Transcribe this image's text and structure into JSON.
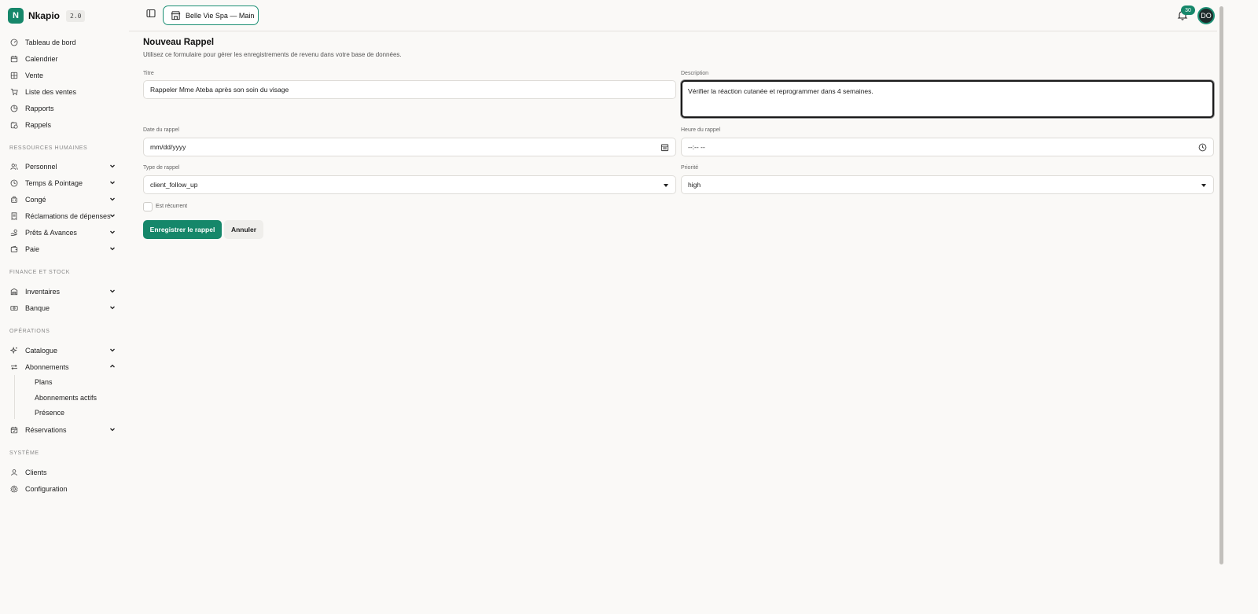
{
  "brand": {
    "logo_letter": "N",
    "name": "Nkapio",
    "version": "2.0"
  },
  "sidebar": {
    "main": [
      {
        "label": "Tableau de bord",
        "icon": "gauge-icon"
      },
      {
        "label": "Calendrier",
        "icon": "calendar-icon"
      },
      {
        "label": "Vente",
        "icon": "grid-icon"
      },
      {
        "label": "Liste des ventes",
        "icon": "cart-icon"
      },
      {
        "label": "Rapports",
        "icon": "pie-chart-icon"
      },
      {
        "label": "Rappels",
        "icon": "calendar-clock-icon"
      }
    ],
    "hr_label": "RESSOURCES HUMAINES",
    "hr": [
      {
        "label": "Personnel",
        "icon": "users-icon"
      },
      {
        "label": "Temps & Pointage",
        "icon": "clock-icon"
      },
      {
        "label": "Congé",
        "icon": "luggage-icon"
      },
      {
        "label": "Réclamations de dépenses",
        "icon": "receipt-icon"
      },
      {
        "label": "Prêts & Avances",
        "icon": "hand-coins-icon"
      },
      {
        "label": "Paie",
        "icon": "wallet-icon"
      }
    ],
    "finance_label": "FINANCE ET STOCK",
    "finance": [
      {
        "label": "Inventaires",
        "icon": "warehouse-icon"
      },
      {
        "label": "Banque",
        "icon": "banknote-icon"
      }
    ],
    "ops_label": "OPÉRATIONS",
    "ops": [
      {
        "label": "Catalogue",
        "icon": "sparkles-icon"
      },
      {
        "label": "Abonnements",
        "icon": "repeat-icon"
      }
    ],
    "subscriptions_sub": [
      "Plans",
      "Abonnements actifs",
      "Présence"
    ],
    "reservations": {
      "label": "Réservations",
      "icon": "calendar-check-icon"
    },
    "system_label": "SYSTÈME",
    "system": [
      {
        "label": "Clients",
        "icon": "user-icon"
      },
      {
        "label": "Configuration",
        "icon": "gear-icon"
      }
    ]
  },
  "topbar": {
    "store": "Belle Vie Spa — Main",
    "notifications": "30",
    "avatar": "DO"
  },
  "form": {
    "title": "Nouveau Rappel",
    "subtitle": "Utilisez ce formulaire pour gérer les enregistrements de revenu dans votre base de données.",
    "titre_label": "Titre",
    "titre_value": "Rappeler Mme Ateba après son soin du visage",
    "description_label": "Description",
    "description_value": "Vérifier la réaction cutanée et reprogrammer dans 4 semaines.",
    "date_label": "Date du rappel",
    "date_placeholder": "mm/dd/yyyy",
    "time_label": "Heure du rappel",
    "time_placeholder": "--:-- --",
    "type_label": "Type de rappel",
    "type_value": "client_follow_up",
    "priority_label": "Priorité",
    "priority_value": "high",
    "recurring_label": "Est récurrent",
    "recurring_checked": false,
    "save_label": "Enregistrer le rappel",
    "cancel_label": "Annuler"
  },
  "colors": {
    "accent": "#16876a",
    "background": "#faf9f7"
  }
}
